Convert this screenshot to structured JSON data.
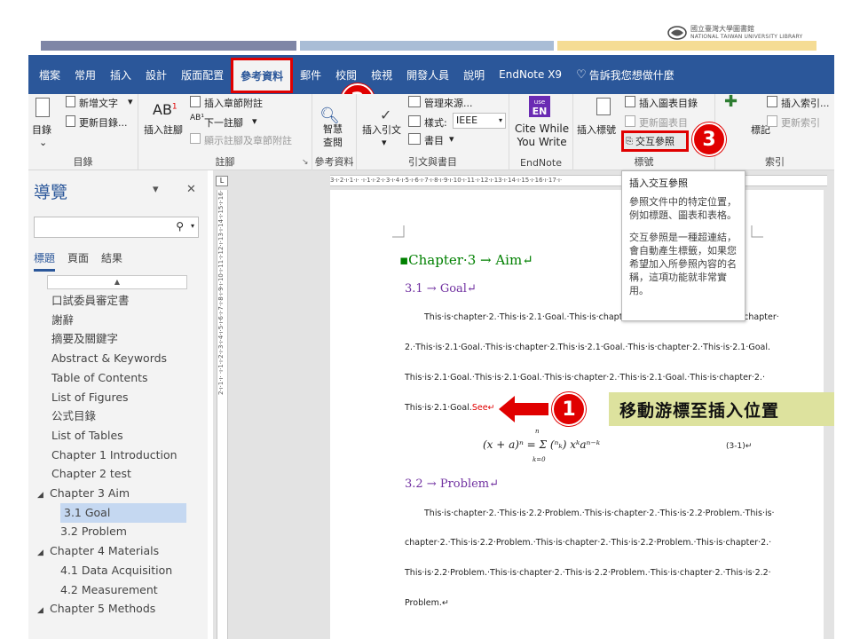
{
  "header": {
    "logo_cn": "國立臺灣大學圖書館",
    "logo_en": "NATIONAL TAIWAN UNIVERSITY LIBRARY",
    "bar_colors": [
      "#7f86a6",
      "#a9bdd6",
      "#f5dc94"
    ]
  },
  "ribbon": {
    "tabs": [
      "檔案",
      "常用",
      "插入",
      "設計",
      "版面配置",
      "參考資料",
      "郵件",
      "校閱",
      "檢視",
      "開發人員",
      "說明",
      "EndNote X9"
    ],
    "tell_me": "告訴我您想做什麼",
    "active_tab": "參考資料",
    "groups": {
      "toc": {
        "label": "目錄",
        "toc_button": "目錄",
        "add_text": "新增文字",
        "update_table": "更新目錄..."
      },
      "footnotes": {
        "label": "註腳",
        "ab_glyph": "AB",
        "insert_footnote": "插入註腳",
        "insert_endnote": "插入章節附註",
        "next_footnote": "下一註腳",
        "show_notes": "顯示註腳及章節附註"
      },
      "research": {
        "label": "參考資料",
        "smart_lookup": "智慧\n查閱"
      },
      "citations": {
        "label": "引文與書目",
        "insert_citation": "插入引文",
        "manage_sources": "管理來源...",
        "style_label": "樣式:",
        "style_value": "IEEE",
        "bibliography": "書目"
      },
      "endnote": {
        "label": "EndNote",
        "badge_top": "use",
        "badge_bottom": "EN",
        "cite_while": "Cite While\nYou Write"
      },
      "captions": {
        "label": "標號",
        "insert_caption": "插入標號",
        "insert_table_of_figures": "插入圖表目錄",
        "update_table": "更新圖表目",
        "cross_reference": "交互參照"
      },
      "index": {
        "label": "索引",
        "mark_entry": "標記",
        "insert_index": "插入索引...",
        "update_index": "更新索引"
      }
    }
  },
  "callouts": {
    "step1": "1",
    "step2": "2",
    "step3": "3",
    "step1_label": "移動游標至插入位置"
  },
  "tooltip": {
    "title": "插入交互參照",
    "p1": "參照文件中的特定位置，例如標題、圖表和表格。",
    "p2": "交互參照是一種超連結，會自動產生標籤，如果您希望加入所參照內容的名稱，這項功能就非常實用。"
  },
  "navigation": {
    "title": "導覽",
    "tabs": [
      "標題",
      "頁面",
      "結果"
    ],
    "scroll_up": "▲",
    "items": [
      {
        "text": "口試委員審定書",
        "level": 1,
        "expand": ""
      },
      {
        "text": "謝辭",
        "level": 1,
        "expand": ""
      },
      {
        "text": "摘要及關鍵字",
        "level": 1,
        "expand": ""
      },
      {
        "text": "Abstract & Keywords",
        "level": 1,
        "expand": ""
      },
      {
        "text": "Table of Contents",
        "level": 1,
        "expand": ""
      },
      {
        "text": "List of Figures",
        "level": 1,
        "expand": ""
      },
      {
        "text": "公式目錄",
        "level": 1,
        "expand": ""
      },
      {
        "text": "List of Tables",
        "level": 1,
        "expand": ""
      },
      {
        "text": "Chapter 1 Introduction",
        "level": 1,
        "expand": ""
      },
      {
        "text": "Chapter 2 test",
        "level": 1,
        "expand": ""
      },
      {
        "text": "Chapter 3 Aim",
        "level": 1,
        "expand": "◢"
      },
      {
        "text": "3.1 Goal",
        "level": 2,
        "expand": "",
        "selected": true
      },
      {
        "text": "3.2 Problem",
        "level": 2,
        "expand": ""
      },
      {
        "text": "Chapter 4 Materials",
        "level": 1,
        "expand": "◢"
      },
      {
        "text": "4.1 Data Acquisition",
        "level": 2,
        "expand": ""
      },
      {
        "text": "4.2 Measurement",
        "level": 2,
        "expand": ""
      },
      {
        "text": "Chapter 5 Methods",
        "level": 1,
        "expand": "◢"
      }
    ]
  },
  "ruler": {
    "corner": "L",
    "horizontal": "3·ı·2·ı·1·ı·  ·ı·1·ı·2·ı·3·ı·4·ı·5·ı·6·ı·7·ı·8·ı·9·ı·10·ı·11·ı·12·ı·13·ı·14·ı·15·ı·16·ı·17·ı·",
    "vertical": "2·ı·1·ı·  ·ı·1·ı·2·ı·3·ı·4·ı·5·ı·6·ı·7·ı·8·ı·9·ı·10·ı·11·ı·12·ı·13·ı·14·ı·15·ı·16·"
  },
  "document": {
    "chapter_heading": "▪Chapter·3 → Aim↵",
    "h_goal": "3.1 → Goal↵",
    "goal_lines": [
      "This·is·chapter·2.·This·is·2.1·Goal.·This·is·chapter·2.·This·is·2.1·Goal.·This·is·chapter·",
      "2.·This·is·2.1·Goal.·This·is·chapter·2.This·is·2.1·Goal.·This·is·chapter·2.·This·is·2.1·Goal.",
      "This·is·2.1·Goal.·This·is·2.1·Goal.·This·is·chapter·2.·This·is·2.1·Goal.·This·is·chapter·2.·",
      "This·is·2.1·Goal."
    ],
    "see_text": "See↵",
    "equation": "(x + a)ⁿ = Σ (ⁿₖ) xᵏaⁿ⁻ᵏ",
    "eq_upper": "n",
    "eq_lower": "k=0",
    "eq_number": "(3-1)↵",
    "h_problem": "3.2 → Problem↵",
    "problem_lines": [
      "This·is·chapter·2.·This·is·2.2·Problem.·This·is·chapter·2.·This·is·2.2·Problem.·This·is·",
      "chapter·2.·This·is·2.2·Problem.·This·is·chapter·2.·This·is·2.2·Problem.·This·is·chapter·2.·",
      "This·is·2.2·Problem.·This·is·chapter·2.·This·is·2.2·Problem.·This·is·chapter·2.·This·is·2.2·",
      "Problem.↵"
    ]
  },
  "colors": {
    "ribbon_blue": "#2b579a",
    "callout_red": "#e00000",
    "heading_green": "#008000",
    "heading_purple": "#7030a0",
    "label_bg": "#dde29e"
  }
}
